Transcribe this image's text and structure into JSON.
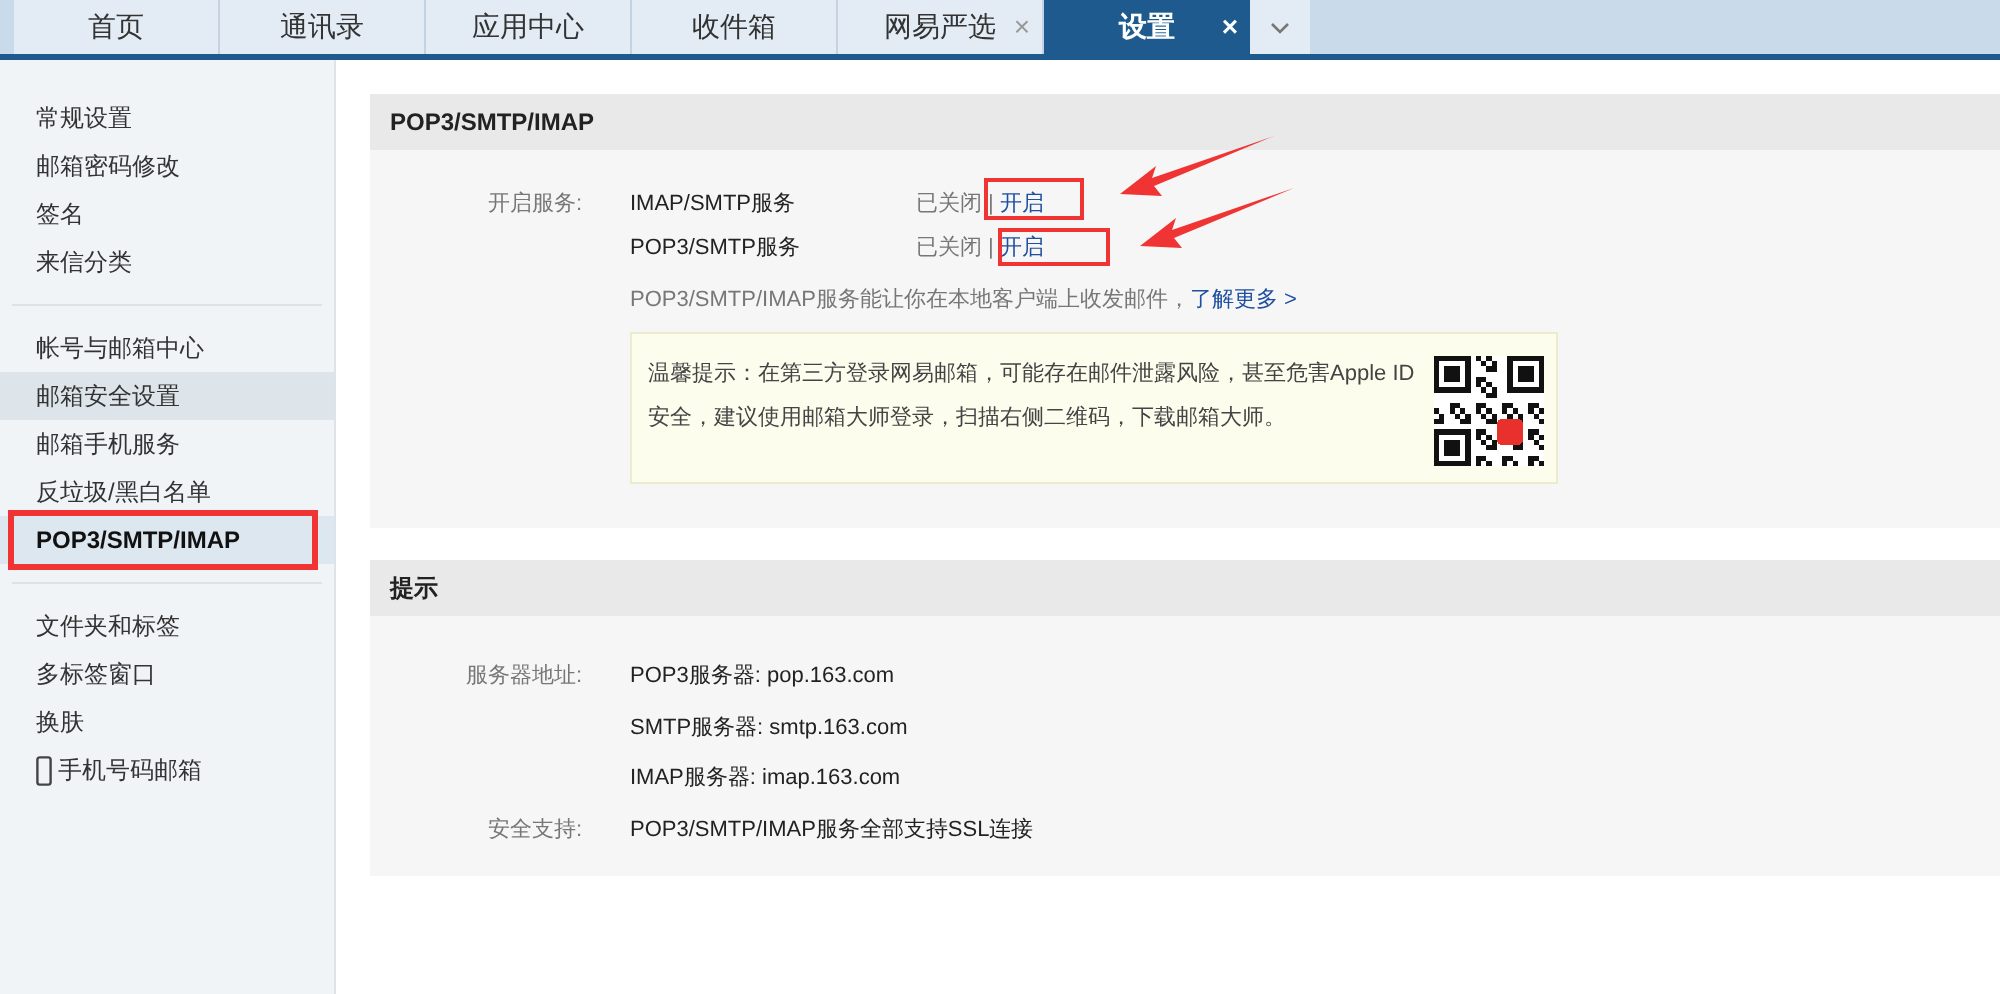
{
  "tabs": [
    {
      "label": "首页",
      "selected": false
    },
    {
      "label": "通讯录",
      "selected": false
    },
    {
      "label": "应用中心",
      "selected": false
    },
    {
      "label": "收件箱",
      "selected": false
    },
    {
      "label": "网易严选",
      "selected": false,
      "close": "×"
    },
    {
      "label": "设置",
      "selected": true,
      "close": "×"
    }
  ],
  "sidebar": {
    "groups": [
      [
        {
          "label": "常规设置",
          "selected": false,
          "hovered": false,
          "annotated": false
        },
        {
          "label": "邮箱密码修改",
          "selected": false,
          "hovered": false,
          "annotated": false
        },
        {
          "label": "签名",
          "selected": false,
          "hovered": false,
          "annotated": false
        },
        {
          "label": "来信分类",
          "selected": false,
          "hovered": false,
          "annotated": false
        }
      ],
      [
        {
          "label": "帐号与邮箱中心",
          "selected": false,
          "hovered": false,
          "annotated": false
        },
        {
          "label": "邮箱安全设置",
          "selected": false,
          "hovered": true,
          "annotated": false
        },
        {
          "label": "邮箱手机服务",
          "selected": false,
          "hovered": false,
          "annotated": false
        },
        {
          "label": "反垃圾/黑白名单",
          "selected": false,
          "hovered": false,
          "annotated": false
        },
        {
          "label": "POP3/SMTP/IMAP",
          "selected": true,
          "hovered": false,
          "annotated": true
        }
      ],
      [
        {
          "label": "文件夹和标签",
          "selected": false,
          "hovered": false,
          "annotated": false
        },
        {
          "label": "多标签窗口",
          "selected": false,
          "hovered": false,
          "annotated": false
        },
        {
          "label": "换肤",
          "selected": false,
          "hovered": false,
          "annotated": false
        },
        {
          "label": "手机号码邮箱",
          "selected": false,
          "hovered": false,
          "annotated": false,
          "kind": "phone"
        }
      ]
    ]
  },
  "panels": [
    {
      "title": "POP3/SMTP/IMAP",
      "kind": "services",
      "label": "开启服务:",
      "services": [
        {
          "name": "IMAP/SMTP服务",
          "status": "已关闭",
          "separator": "|",
          "action": "开启",
          "annotated": true
        },
        {
          "name": "POP3/SMTP服务",
          "status": "已关闭",
          "separator": "|",
          "action": "开启",
          "annotated": true
        }
      ],
      "description": "POP3/SMTP/IMAP服务能让你在本地客户端上收发邮件，",
      "learn_more": "了解更多 >",
      "tip": "温馨提示：在第三方登录网易邮箱，可能存在邮件泄露风险，甚至危害Apple ID安全，建议使用邮箱大师登录，扫描右侧二维码，下载邮箱大师。"
    },
    {
      "title": "提示",
      "kind": "info",
      "rows": [
        {
          "label": "服务器地址:",
          "values": [
            "POP3服务器: pop.163.com",
            "SMTP服务器: smtp.163.com",
            "IMAP服务器: imap.163.com"
          ]
        },
        {
          "label": "安全支持:",
          "values": [
            "POP3/SMTP/IMAP服务全部支持SSL连接"
          ]
        }
      ]
    }
  ]
}
